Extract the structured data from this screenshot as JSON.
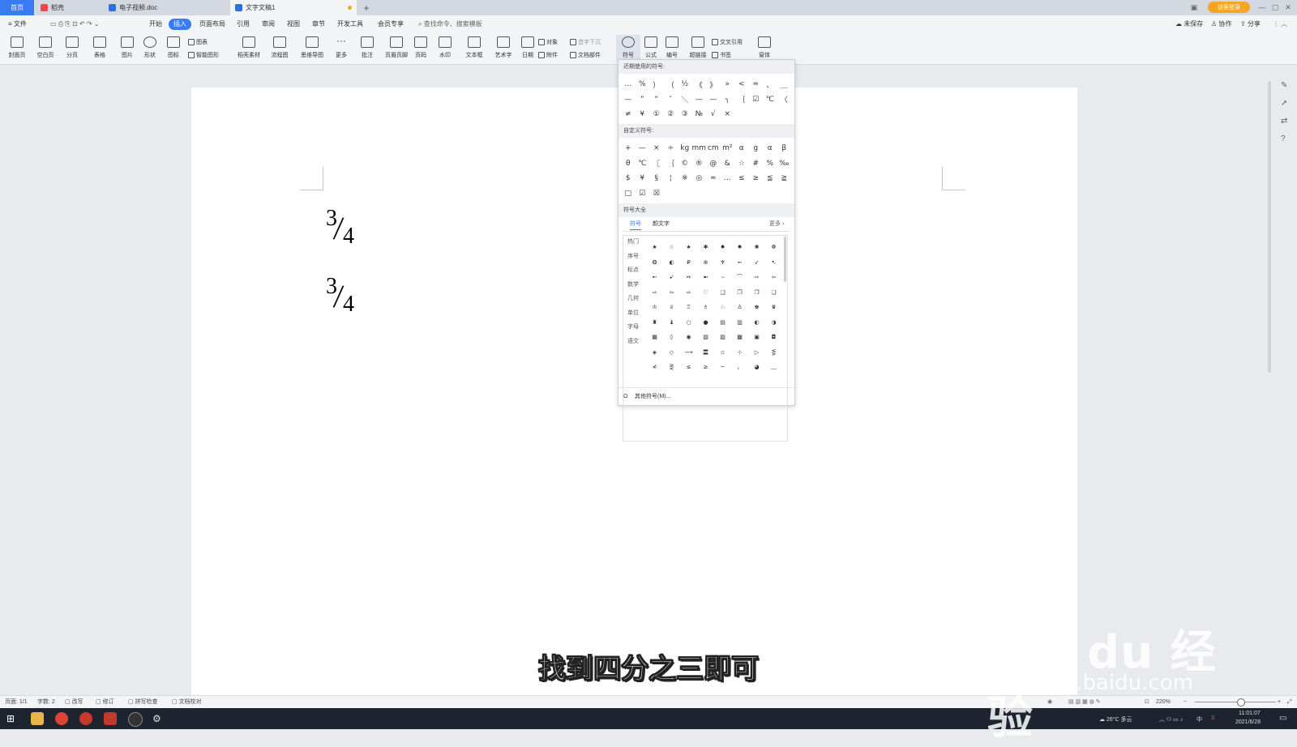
{
  "tabs": {
    "home": "首页",
    "daoke": "稻壳",
    "doc1": "电子视频.doc",
    "doc2": "文字文稿1",
    "add": "+"
  },
  "login": "访客登录",
  "menus": [
    "文件",
    "开始",
    "插入",
    "页面布局",
    "引用",
    "审阅",
    "视图",
    "章节",
    "开发工具",
    "会员专享"
  ],
  "search_placeholder": "查找命令、搜索模板",
  "top_right": {
    "unsaved": "未保存",
    "collab": "协作",
    "share": "分享"
  },
  "ribbon": {
    "cover": "封面页",
    "blank": "空白页",
    "pagebreak": "分页",
    "table": "表格",
    "picture": "图片",
    "shape": "形状",
    "icon": "图标",
    "chart": "图表",
    "smart": "智能图形",
    "material": "稻壳素材",
    "flow": "流程图",
    "mind": "思维导图",
    "more": "更多",
    "comment": "批注",
    "headerfooter": "页眉页脚",
    "pagenum": "页码",
    "watermark": "水印",
    "textbox": "文本框",
    "wordart": "艺术字",
    "date": "日期",
    "object": "对象",
    "dropcap": "首字下沉",
    "attach": "附件",
    "docpart": "文档部件",
    "symbol": "符号",
    "formula": "公式",
    "number": "编号",
    "hyperlink": "超链接",
    "crossref": "交叉引用",
    "bookmark": "书签",
    "window": "窗体"
  },
  "document": {
    "frac1": {
      "num": "3",
      "slash": "/",
      "den": "4"
    },
    "frac2": {
      "num": "3",
      "slash": "/",
      "den": "4"
    }
  },
  "symbol_panel": {
    "recent_title": "近期使用的符号:",
    "recent": [
      "…",
      "%",
      "）",
      "（",
      "½",
      "《",
      "》",
      "»",
      "<",
      "≈",
      "、",
      "＿",
      "—",
      "”",
      "“",
      "″",
      "＼",
      "—",
      "—",
      "╮",
      "｛",
      "☑",
      "℃",
      "〈",
      "≠",
      "¥",
      "①",
      "②",
      "③",
      "№",
      "√",
      "×"
    ],
    "custom_title": "自定义符号:",
    "custom": [
      "+",
      "—",
      "×",
      "÷",
      "kg",
      "mm",
      "cm",
      "m²",
      "α",
      "g",
      "α",
      "β",
      "θ",
      "℃",
      "〖",
      "｛",
      "©",
      "®",
      "@",
      "&",
      "☆",
      "#",
      "%",
      "‰",
      "$",
      "¥",
      "§",
      "¦",
      "※",
      "◎",
      "≈",
      "…",
      "≤",
      "≥",
      "≦",
      "≧",
      "□",
      "☑",
      "☒"
    ],
    "all_title": "符号大全",
    "all_tab_symbol": "符号",
    "all_tab_emoticon": "颜文字",
    "all_more": "更多",
    "categories": [
      "热门",
      "序号",
      "标点",
      "数学",
      "几何",
      "单位",
      "字母",
      "语文"
    ],
    "all": [
      "★",
      "☆",
      "★",
      "✱",
      "✸",
      "✹",
      "✺",
      "❁",
      "❂",
      "◐",
      "₽",
      "⊕",
      "♆",
      "➻",
      "➶",
      "➷",
      "➸",
      "➹",
      "➺",
      "➼",
      "⌣",
      "⌒",
      "⇨",
      "⇦",
      "⇨",
      "⇦",
      "⇨",
      "♡",
      "❑",
      "❒",
      "❐",
      "❏",
      "♔",
      "♕",
      "♖",
      "♗",
      "♘",
      "♙",
      "♚",
      "♛",
      "♜",
      "♝",
      "○",
      "●",
      "▤",
      "▥",
      "◐",
      "◑",
      "▦",
      "◊",
      "◉",
      "▧",
      "▨",
      "▩",
      "▣",
      "◘",
      "◈",
      "◇",
      "⟶",
      "〓",
      "▫",
      "⊹",
      "▷",
      "⋚",
      "≮",
      "⋛",
      "≤",
      "≥",
      "~",
      "，",
      "◕",
      "﹏"
    ],
    "other": "其他符号(M)..."
  },
  "status": {
    "page": "页面: 1/1",
    "words": "字数: 2",
    "spell": "改写",
    "revise": "修订",
    "check": "拼写检查",
    "proof": "文档校对",
    "zoom": "220%"
  },
  "taskbar": {
    "weather": "26°C 多云",
    "lang": "中",
    "time": "11:01:07",
    "date": "2021/6/28"
  },
  "subtitle": "找到四分之三即可",
  "watermark": {
    "brand": "Bai du 经验",
    "url": "jingyan.baidu.com"
  }
}
